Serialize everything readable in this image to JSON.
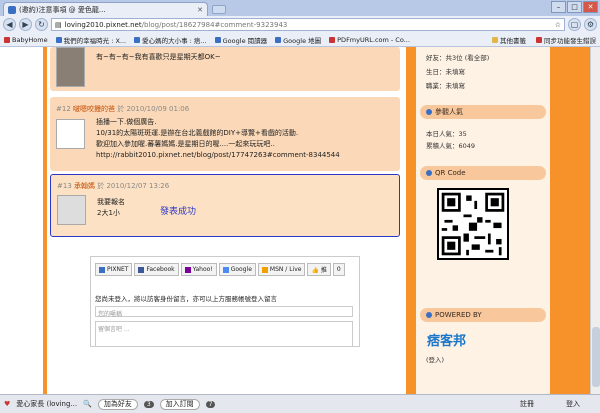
{
  "tab": {
    "title": "(邀約)注意事項 @ 愛色龍..."
  },
  "address": {
    "host": "loving2010.pixnet.net",
    "rest": "/blog/post/18627984#comment-9323943"
  },
  "bookmarks": [
    "BabyHome",
    "我們的幸福時光 : X...",
    "愛心媽的大小事 : 痞...",
    "Google 閱讀器",
    "Google 地圖",
    "PDFmyURL.com - Co..."
  ],
  "bookmarks_right": [
    "其他書籤",
    "同步功能發生錯誤"
  ],
  "comments": [
    {
      "text": "有~有~有~我有喜歡只是星期天都OK~"
    },
    {
      "num": "#12",
      "name": "啵嗯咬饅的爸",
      "meta": "於 2010/10/09 01:06",
      "lines": [
        "插播一下.做個廣告.",
        "10/31的太陽斑斑運.是辦在台北義戲館的DIY+導覽+看戲的活動.",
        "歡迎加入參加喔.蕃薯媽媽.是星期日的喔....一起來玩玩吧..",
        "http://rabbit2010.pixnet.net/blog/post/17747263#comment-8344544"
      ]
    },
    {
      "num": "#13",
      "name": "承翰媽",
      "meta": "於 2010/12/07 13:26",
      "lines": [
        "我要報名",
        "2大1小"
      ]
    }
  ],
  "success_text": "發表成功",
  "sns": [
    "PIXNET",
    "Facebook",
    "Yahoo!",
    "Google",
    "MSN / Live"
  ],
  "login": {
    "prompt": "您尚未登入，將以訪客身份留言，亦可以上方服務帳號登入留言",
    "name_placeholder": "您的暱稱",
    "msg_placeholder": "留個言吧 ..."
  },
  "sidebar": {
    "friends": "好友：共3位 (看全部)",
    "birthday": "生日：未填寫",
    "zodiac": "職業：未填寫",
    "popularity_title": "參觀人氣",
    "today": "本日人氣：35",
    "total": "累積人氣：6049",
    "qr_title": "QR Code",
    "powered_title": "POWERED BY",
    "logo": "痞客邦",
    "login_link": "(登入)"
  },
  "status": {
    "user": "愛心家長 (loving...",
    "add_friend": "加為好友",
    "count1": "3",
    "subscribe": "加入訂閱",
    "count2": "7",
    "right1": "註冊",
    "right2": "登入"
  },
  "chart_data": null
}
